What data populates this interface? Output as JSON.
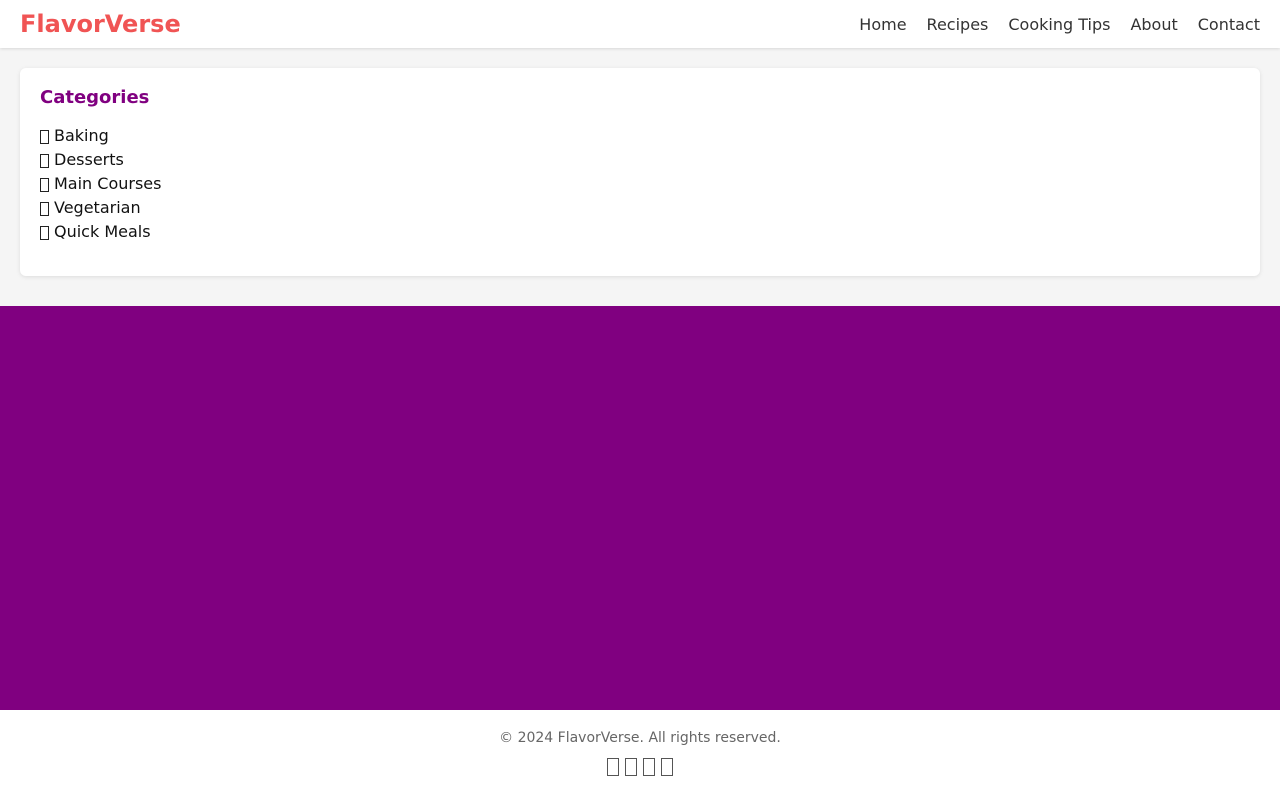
{
  "brand": {
    "name": "FlavorVerse",
    "color": "#f05454"
  },
  "nav": {
    "links": [
      "Home",
      "Recipes",
      "Cooking Tips",
      "About",
      "Contact"
    ]
  },
  "categories": {
    "title": "Categories",
    "title_color": "#800080",
    "items": [
      {
        "icon": "category-icon",
        "label": "Baking"
      },
      {
        "icon": "category-icon",
        "label": "Desserts"
      },
      {
        "icon": "category-icon",
        "label": "Main Courses"
      },
      {
        "icon": "category-icon",
        "label": "Vegetarian"
      },
      {
        "icon": "category-icon",
        "label": "Quick Meals"
      }
    ]
  },
  "band": {
    "color": "#800080"
  },
  "footer": {
    "copyright": "© 2024 FlavorVerse. All rights reserved.",
    "social_icons": [
      "social-icon-1",
      "social-icon-2",
      "social-icon-3",
      "social-icon-4"
    ]
  }
}
